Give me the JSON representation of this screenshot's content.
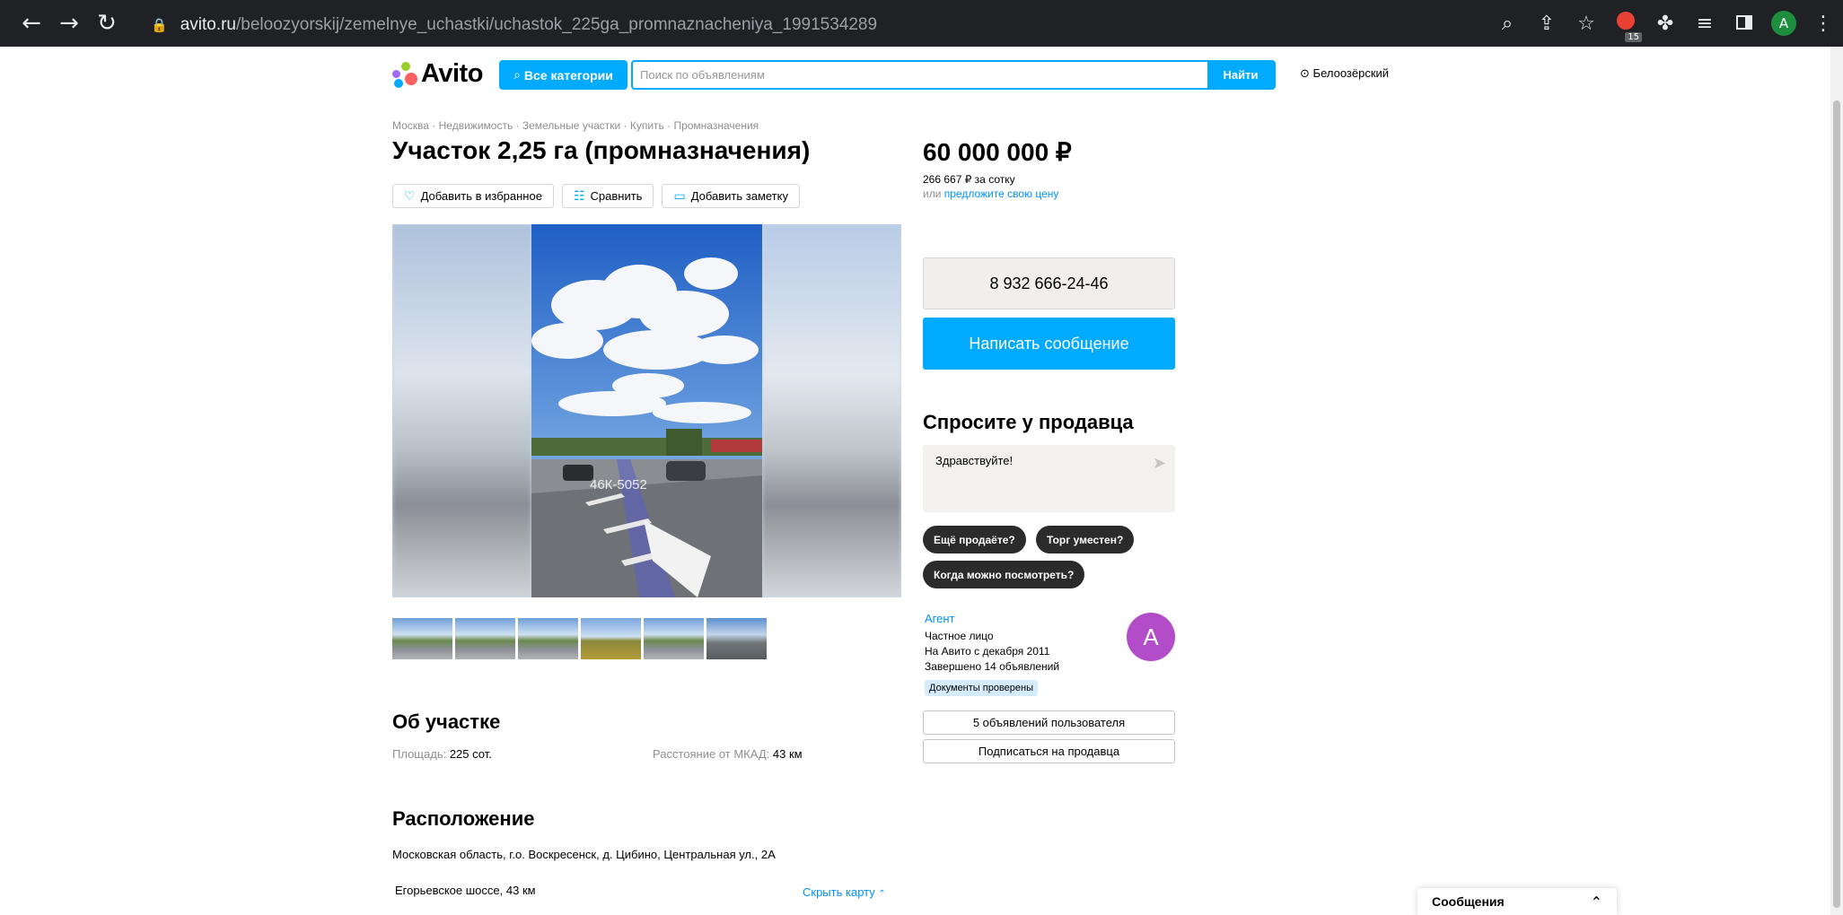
{
  "browser": {
    "url_domain": "avito.ru",
    "url_path": "/beloozyorskij/zemelnye_uchastki/uchastok_225ga_promnaznacheniya_1991534289",
    "extension_badge": "15",
    "profile_letter": "A"
  },
  "header": {
    "logo_text": "Avito",
    "categories_label": "Все категории",
    "search_placeholder": "Поиск по объявлениям",
    "search_button": "Найти",
    "location": "Белоозёрский"
  },
  "listing": {
    "breadcrumb": "Москва · Недвижимость · Земельные участки · Купить · Промназначения",
    "title": "Участок 2,25 га (промназначения)",
    "actions": {
      "favorite": "Добавить в избранное",
      "compare": "Сравнить",
      "note": "Добавить заметку"
    },
    "photo_road_label": "46К-5052"
  },
  "about": {
    "heading": "Об участке",
    "area_label": "Площадь:",
    "area_value": "225 сот.",
    "distance_label": "Расстояние от МКАД:",
    "distance_value": "43 км"
  },
  "location_section": {
    "heading": "Расположение",
    "address": "Московская область, г.о. Воскресенск, д. Цибино, Центральная ул., 2А",
    "road": "Егорьевское шоссе, 43 км",
    "hide_map": "Скрыть карту"
  },
  "price": {
    "value": "60 000 000 ₽",
    "per_unit": "266 667 ₽ за сотку",
    "offer_prefix": "или ",
    "offer_link": "предложите свою цену"
  },
  "contact": {
    "phone": "8 932 666-24-46",
    "message_button": "Написать сообщение"
  },
  "ask": {
    "heading": "Спросите у продавца",
    "input_value": "Здравствуйте!",
    "chips": [
      "Ещё продаёте?",
      "Торг уместен?",
      "Когда можно посмотреть?"
    ]
  },
  "seller": {
    "name": "Агент",
    "type": "Частное лицо",
    "since": "На Авито с декабря 2011",
    "completed": "Завершено 14 объявлений",
    "avatar_letter": "A",
    "docs_badge": "Документы проверены",
    "listings_button": "5 объявлений пользователя",
    "subscribe_button": "Подписаться на продавца"
  },
  "messages_widget": {
    "label": "Сообщения"
  },
  "colors": {
    "accent": "#00aaff",
    "link": "#0091ff",
    "avatar": "#b24cc8"
  }
}
